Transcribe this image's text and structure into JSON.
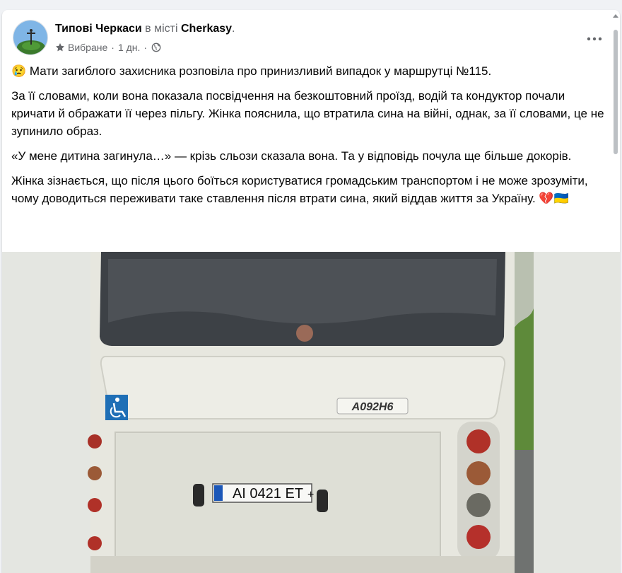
{
  "post": {
    "page_name": "Типові Черкаси",
    "in_city": " в місті ",
    "city": "Cherkasy",
    "city_suffix": ".",
    "badge": "Вибране",
    "dot": "·",
    "time": "1 дн.",
    "dot2": "·",
    "more_label": "•••",
    "paragraphs": [
      "😢 Мати загиблого захисника розповіла про принизливий випадок у маршрутці №115.",
      "За її словами, коли вона показала посвідчення на безкоштовний проїзд, водій та кондуктор почали кричати й ображати її через пільгу. Жінка пояснила, що втратила сина на війні, однак, за її словами, це не зупинило образ.",
      "«У мене дитина загинула…» — крізь сльози сказала вона. Та у відповідь почула ще більше докорів.",
      "Жінка зізнається, що після цього боїться користуватися громадським транспортом і не може зрозуміти, чому доводиться переживати таке ставлення після втрати сина, який віддав життя за Україну. 💔🇺🇦"
    ]
  },
  "photo": {
    "bus_model": "A092H6",
    "plate": "AI 0421 ET",
    "plate_suffix": "+"
  },
  "icons": {
    "more": "more-horizontal-icon",
    "favorite": "star-icon",
    "audience": "globe-icon",
    "avatar": "page-avatar",
    "accessibility": "wheelchair-icon"
  },
  "colors": {
    "background": "#f0f2f5",
    "card": "#ffffff",
    "secondary_text": "#65676b",
    "primary_text": "#050505",
    "sign_blue": "#1f6fb6",
    "bus_body": "#e7e7df"
  }
}
